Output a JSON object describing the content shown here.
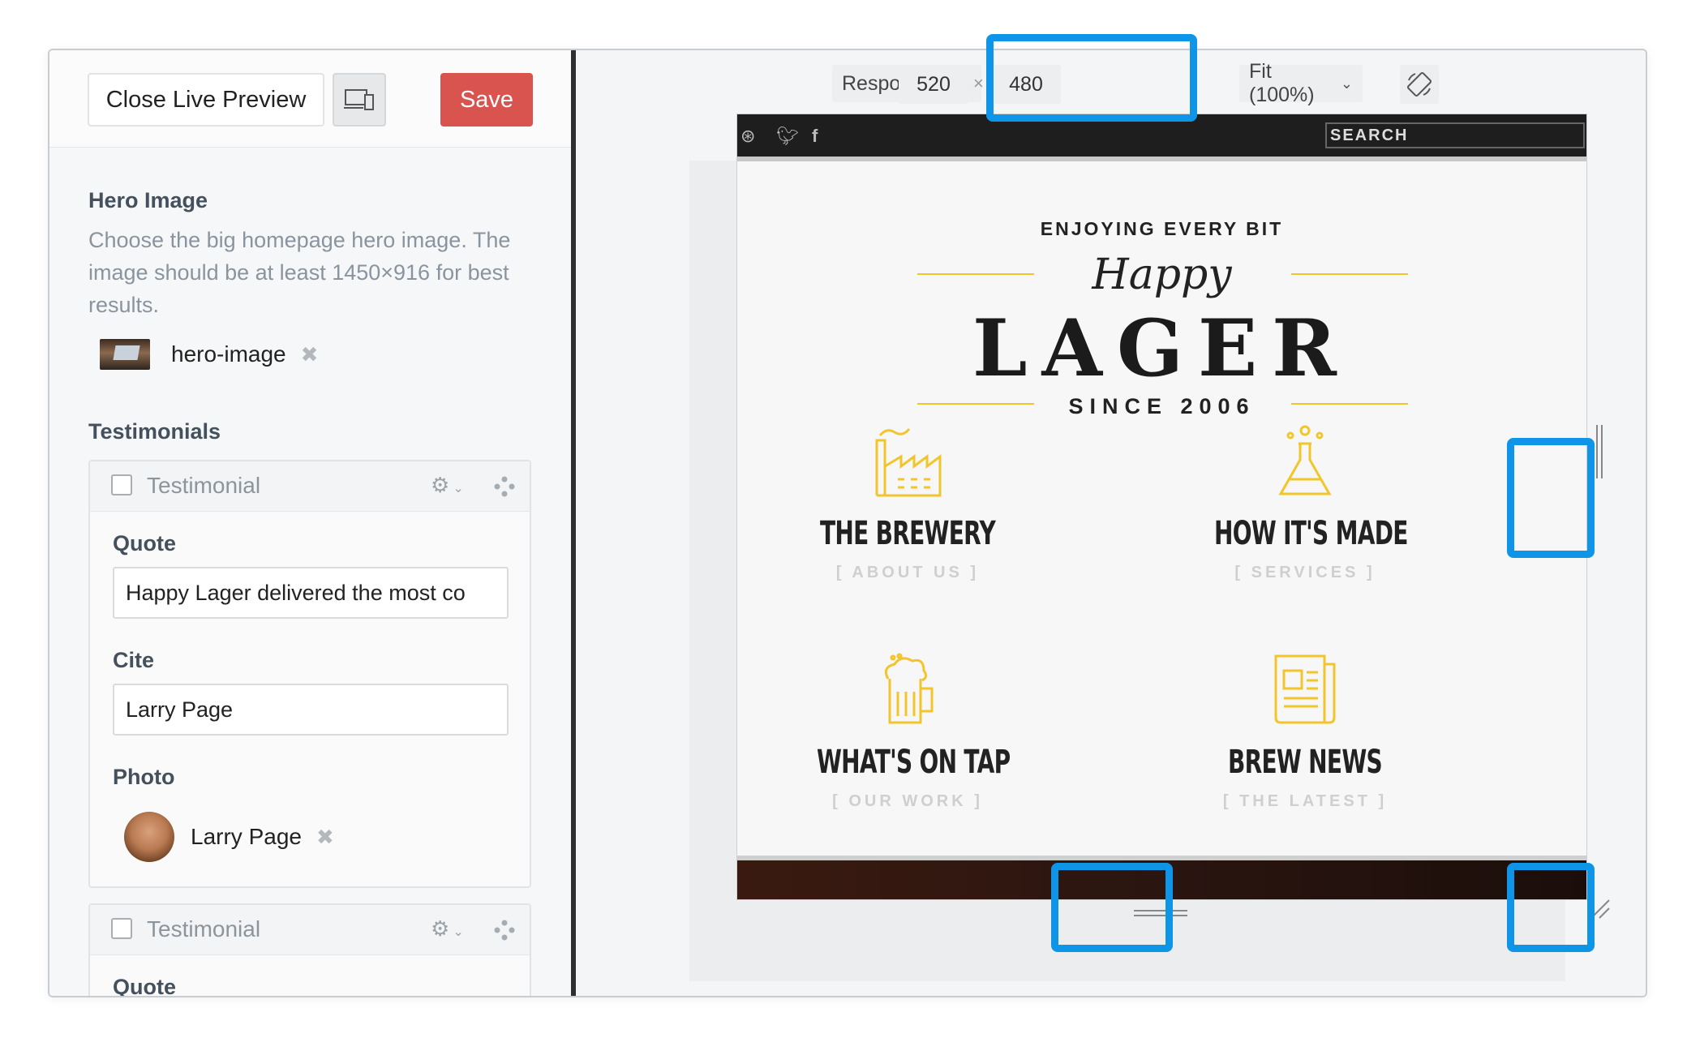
{
  "toolbar": {
    "close_label": "Close Live Preview",
    "save_label": "Save",
    "responsive_label": "Responsive",
    "width": "520",
    "times": "×",
    "height": "480",
    "fit_label": "Fit (100%)"
  },
  "hero": {
    "title": "Hero Image",
    "description": "Choose the big homepage hero image. The image should be at least 1450×916 for best results.",
    "file_name": "hero-image"
  },
  "testimonials": {
    "title": "Testimonials",
    "items": [
      {
        "header": "Testimonial",
        "quote_label": "Quote",
        "quote_value": "Happy Lager delivered the most co",
        "cite_label": "Cite",
        "cite_value": "Larry Page",
        "photo_label": "Photo",
        "photo_name": "Larry Page"
      },
      {
        "header": "Testimonial",
        "quote_label": "Quote"
      }
    ]
  },
  "site": {
    "search_placeholder": "SEARCH",
    "tagline": "ENJOYING EVERY BIT",
    "script": "Happy",
    "name": "LAGER",
    "since": "SINCE 2006",
    "features": [
      {
        "title": "THE BREWERY",
        "sub": "[ ABOUT US ]",
        "icon": "factory-icon"
      },
      {
        "title": "HOW IT'S MADE",
        "sub": "[ SERVICES ]",
        "icon": "flask-icon"
      },
      {
        "title": "WHAT'S ON TAP",
        "sub": "[ OUR WORK ]",
        "icon": "beer-mug-icon"
      },
      {
        "title": "BREW NEWS",
        "sub": "[ THE LATEST ]",
        "icon": "newspaper-icon"
      }
    ]
  },
  "colors": {
    "save": "#d9534f",
    "highlight": "#0f95e8",
    "gold": "#f2c52b"
  }
}
